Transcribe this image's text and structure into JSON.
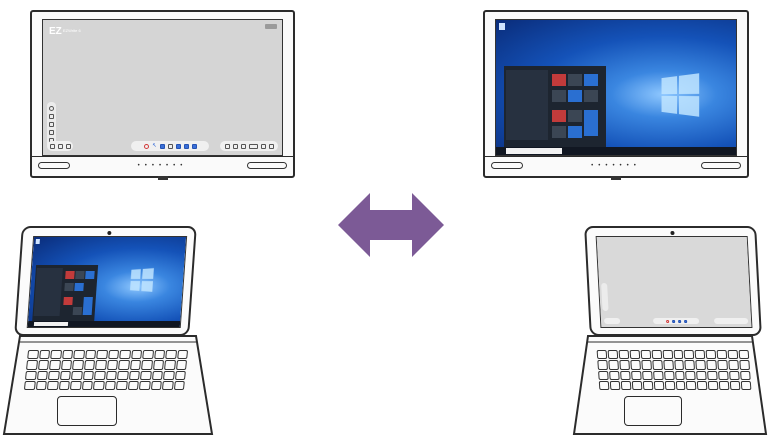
{
  "colors": {
    "arrow": "#7c5a96",
    "whiteboard_canvas": "#d5d5d5",
    "windows_accent": "#1a5bc4",
    "frame": "#2b2b2b"
  },
  "displays": [
    {
      "id": "ifp-left",
      "content": "whiteboard",
      "brand": "EZ",
      "app": "EZWrite 6"
    },
    {
      "id": "ifp-right",
      "content": "windows-desktop"
    }
  ],
  "laptops": [
    {
      "id": "laptop-left",
      "content": "windows-desktop"
    },
    {
      "id": "laptop-right",
      "content": "whiteboard"
    }
  ],
  "connector": {
    "icon": "bidirectional-arrow-icon"
  }
}
